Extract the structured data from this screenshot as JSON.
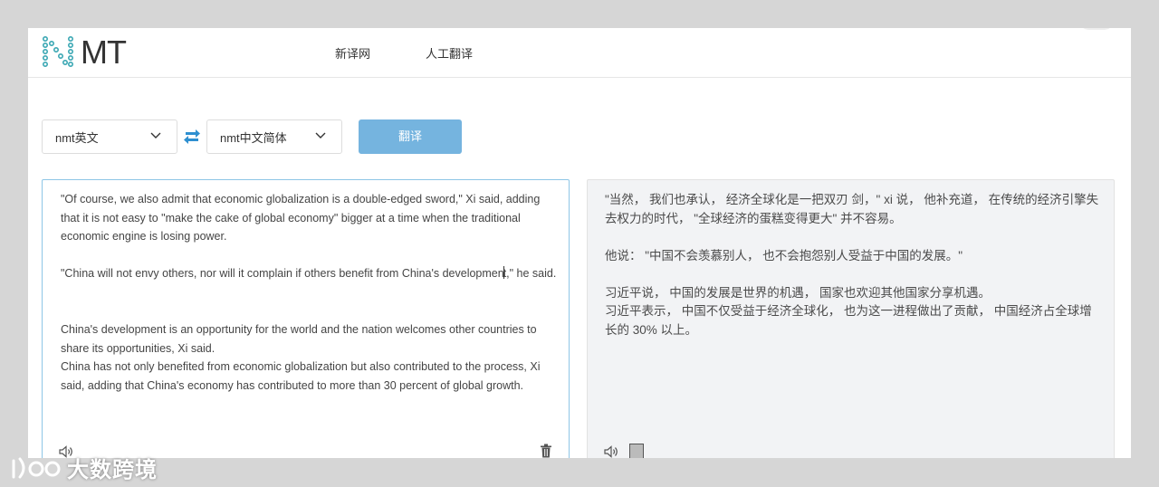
{
  "header": {
    "logo_text": "MT",
    "nav": [
      {
        "label": "新译网"
      },
      {
        "label": "人工翻译"
      }
    ]
  },
  "toolbar": {
    "source_lang": "nmt英文",
    "target_lang": "nmt中文简体",
    "translate_label": "翻译"
  },
  "source": {
    "paragraphs": [
      "\"Of course, we also admit that economic globalization is a double-edged sword,\" Xi said, adding that it is not easy to \"make the cake of global economy\" bigger at a time when the traditional economic engine is losing power.",
      "\"China will not envy others, nor will it complain if others benefit from China's development,\" he said.",
      "China's development is an opportunity for the world and the nation welcomes other countries to share its opportunities, Xi said.",
      "China has not only benefited from economic globalization but also contributed to the process, Xi said, adding that China's economy has contributed to more than 30 percent of global growth."
    ],
    "p2_before_caret": "\"China will not envy others, nor will it complain if others benefit from China's developmen",
    "p2_after_caret": "t,\" he said."
  },
  "target": {
    "paragraphs": [
      "\"当然， 我们也承认， 经济全球化是一把双刃 剑，\" xi 说， 他补充道， 在传统的经济引擎失去权力的时代， \"全球经济的蛋糕变得更大\" 并不容易。",
      "他说： \"中国不会羡慕别人， 也不会抱怨别人受益于中国的发展。\"",
      "习近平说， 中国的发展是世界的机遇， 国家也欢迎其他国家分享机遇。",
      "习近平表示， 中国不仅受益于经济全球化， 也为这一进程做出了贡献， 中国经济占全球增长的 30% 以上。"
    ]
  },
  "watermark": {
    "text": "大数跨境"
  },
  "colors": {
    "accent": "#75b4df",
    "swap_icon": "#2e8fd0",
    "logo_dots": "#3aa7b3"
  }
}
